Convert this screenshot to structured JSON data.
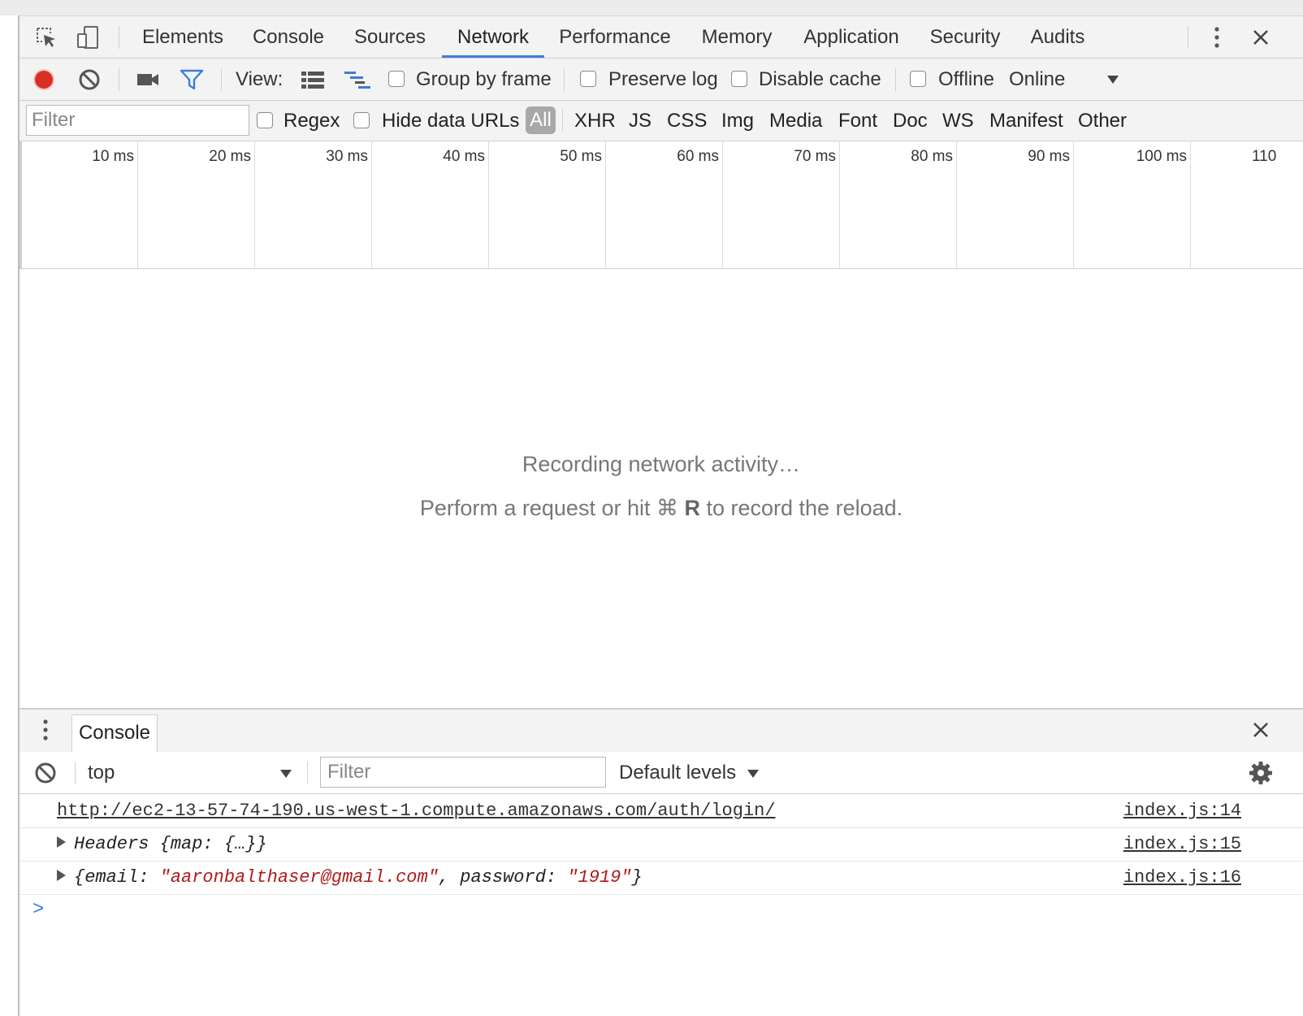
{
  "main_tabs": [
    "Elements",
    "Console",
    "Sources",
    "Network",
    "Performance",
    "Memory",
    "Application",
    "Security",
    "Audits"
  ],
  "active_tab": "Network",
  "network_toolbar": {
    "view_label": "View:",
    "group_by_frame": "Group by frame",
    "preserve_log": "Preserve log",
    "disable_cache": "Disable cache",
    "offline": "Offline",
    "throttle": "Online"
  },
  "filter_bar": {
    "placeholder": "Filter",
    "regex": "Regex",
    "hide_data_urls": "Hide data URLs",
    "all": "All",
    "types": [
      "XHR",
      "JS",
      "CSS",
      "Img",
      "Media",
      "Font",
      "Doc",
      "WS",
      "Manifest",
      "Other"
    ]
  },
  "timeline": {
    "ticks": [
      "10 ms",
      "20 ms",
      "30 ms",
      "40 ms",
      "50 ms",
      "60 ms",
      "70 ms",
      "80 ms",
      "90 ms",
      "100 ms",
      "110"
    ]
  },
  "empty_state": {
    "line1": "Recording network activity…",
    "line2_pre": "Perform a request or hit ⌘ ",
    "line2_key": "R",
    "line2_post": " to record the reload."
  },
  "drawer": {
    "tab": "Console",
    "context": "top",
    "filter_placeholder": "Filter",
    "levels": "Default levels"
  },
  "console_logs": [
    {
      "url": "http://ec2-13-57-74-190.us-west-1.compute.amazonaws.com/auth/login/",
      "source": "index.js:14"
    },
    {
      "headers_name": "Headers",
      "headers_body": "{map: {…}}",
      "source": "index.js:15"
    },
    {
      "email": "aaronbalthaser@gmail.com",
      "password": "1919",
      "source": "index.js:16"
    }
  ],
  "colors": {
    "record": "#d93025",
    "accent": "#3b7ddd",
    "string": "#b11a1a"
  }
}
